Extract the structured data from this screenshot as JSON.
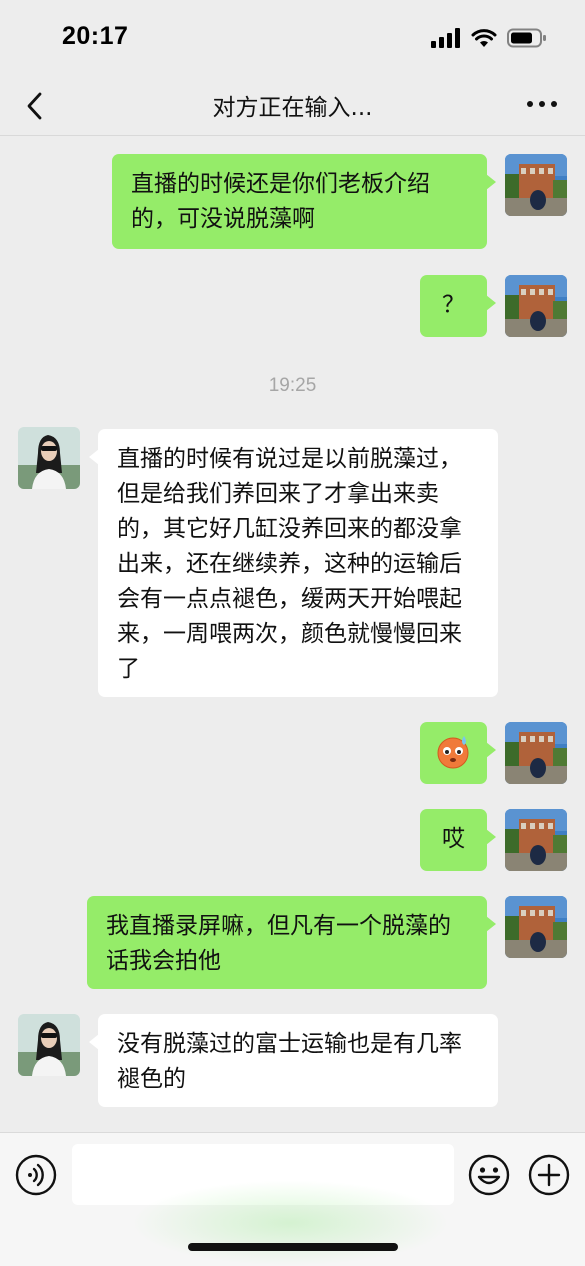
{
  "status_bar": {
    "time": "20:17"
  },
  "nav": {
    "title": "对方正在输入..."
  },
  "messages": [
    {
      "side": "me",
      "text": "直播的时候还是你们老板介绍的，可没说脱藻啊"
    },
    {
      "side": "me",
      "text": "？"
    },
    {
      "type": "time",
      "text": "19:25"
    },
    {
      "side": "other",
      "text": "直播的时候有说过是以前脱藻过，但是给我们养回来了才拿出来卖的，其它好几缸没养回来的都没拿出来，还在继续养，这种的运输后会有一点点褪色，缓两天开始喂起来，一周喂两次，颜色就慢慢回来了"
    },
    {
      "side": "me",
      "emoji": "sweat-emoji"
    },
    {
      "side": "me",
      "text": "哎"
    },
    {
      "side": "me",
      "text": "我直播录屏嘛，但凡有一个脱藻的话我会拍他"
    },
    {
      "side": "other",
      "text": "没有脱藻过的富士运输也是有几率褪色的"
    }
  ],
  "input": {
    "placeholder": ""
  },
  "colors": {
    "my_bubble": "#95ec69",
    "other_bubble": "#ffffff",
    "background": "#ededed"
  }
}
